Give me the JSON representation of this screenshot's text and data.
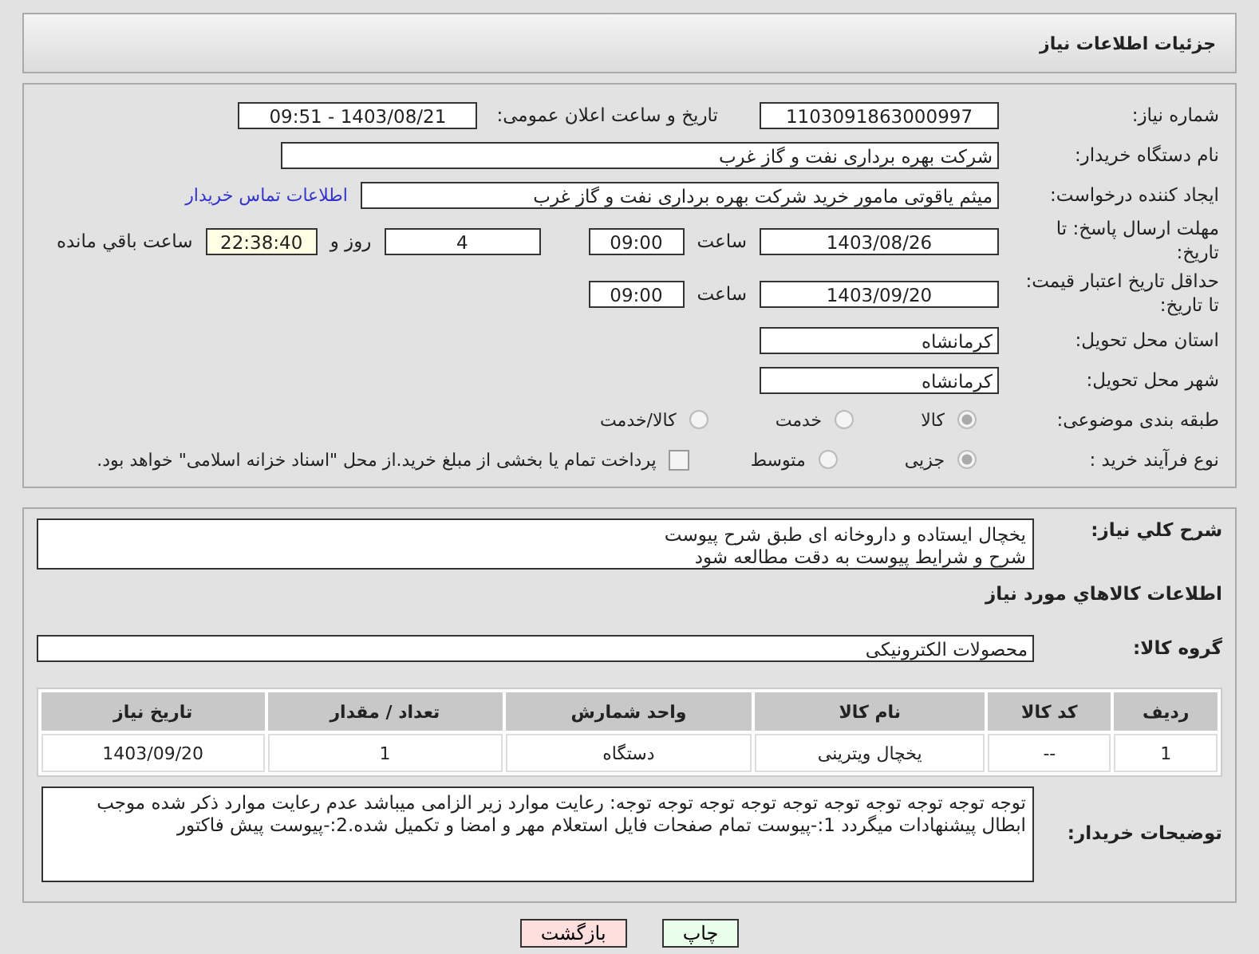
{
  "header": {
    "title": "جزئیات اطلاعات نیاز"
  },
  "need_number": {
    "label": "شماره نیاز:",
    "value": "1103091863000997"
  },
  "announce": {
    "label": "تاریخ و ساعت اعلان عمومی:",
    "value": "1403/08/21 - 09:51"
  },
  "buyer_org": {
    "label": "نام دستگاه خریدار:",
    "value": "شرکت بهره برداری نفت و گاز غرب"
  },
  "creator": {
    "label": "ایجاد کننده درخواست:",
    "value": "میثم یاقوتی مامور خرید شرکت بهره برداری نفت و گاز غرب",
    "link": "اطلاعات تماس خریدار"
  },
  "deadline": {
    "label": "مهلت ارسال پاسخ: تا تاریخ:",
    "date": "1403/08/26",
    "time_label": "ساعت",
    "time": "09:00",
    "days": "4",
    "days_label": "روز و",
    "remaining": "22:38:40",
    "remaining_label": "ساعت باقي مانده"
  },
  "validity": {
    "label": "حداقل تاریخ اعتبار قیمت: تا تاریخ:",
    "date": "1403/09/20",
    "time_label": "ساعت",
    "time": "09:00"
  },
  "province": {
    "label": "استان محل تحویل:",
    "value": "کرمانشاه"
  },
  "city": {
    "label": "شهر محل تحویل:",
    "value": "کرمانشاه"
  },
  "category": {
    "label": "طبقه بندی موضوعی:",
    "options": [
      {
        "label": "کالا",
        "selected": true
      },
      {
        "label": "خدمت",
        "selected": false
      },
      {
        "label": "کالا/خدمت",
        "selected": false
      }
    ]
  },
  "purchase_type": {
    "label": "نوع فرآیند خرید :",
    "options": [
      {
        "label": "جزیی",
        "selected": true
      },
      {
        "label": "متوسط",
        "selected": false
      }
    ],
    "treasury": {
      "label": "پرداخت تمام یا بخشی از مبلغ خرید.از محل \"اسناد خزانه اسلامی\" خواهد بود.",
      "checked": false
    }
  },
  "description": {
    "label": "شرح کلي نياز:",
    "lines": [
      "یخچال ایستاده و داروخانه ای طبق شرح پیوست",
      "شرح و شرایط پیوست به دقت مطالعه شود"
    ]
  },
  "goods_title": "اطلاعات کالاهاي مورد نياز",
  "goods_group": {
    "label": "گروه کالا:",
    "value": "محصولات الکترونیکی"
  },
  "table": {
    "columns": [
      "ردیف",
      "کد کالا",
      "نام کالا",
      "واحد شمارش",
      "تعداد / مقدار",
      "تاریخ نیاز"
    ],
    "rows": [
      [
        "1",
        "--",
        "یخچال ویترینی",
        "دستگاه",
        "1",
        "1403/09/20"
      ]
    ]
  },
  "buyer_notes": {
    "label": "توضیحات خریدار:",
    "value": "توجه توجه توجه توجه توجه توجه توجه توجه توجه توجه: رعایت موارد زیر الزامی میباشد عدم رعایت موارد ذکر شده موجب ابطال پیشنهادات میگردد 1:-پیوست تمام صفحات  فایل استعلام مهر و امضا و تکمیل شده.2:-پیوست پیش فاکتور"
  },
  "buttons": [
    {
      "label": "چاپ",
      "kind": "print"
    },
    {
      "label": "بازگشت",
      "kind": "back"
    }
  ]
}
